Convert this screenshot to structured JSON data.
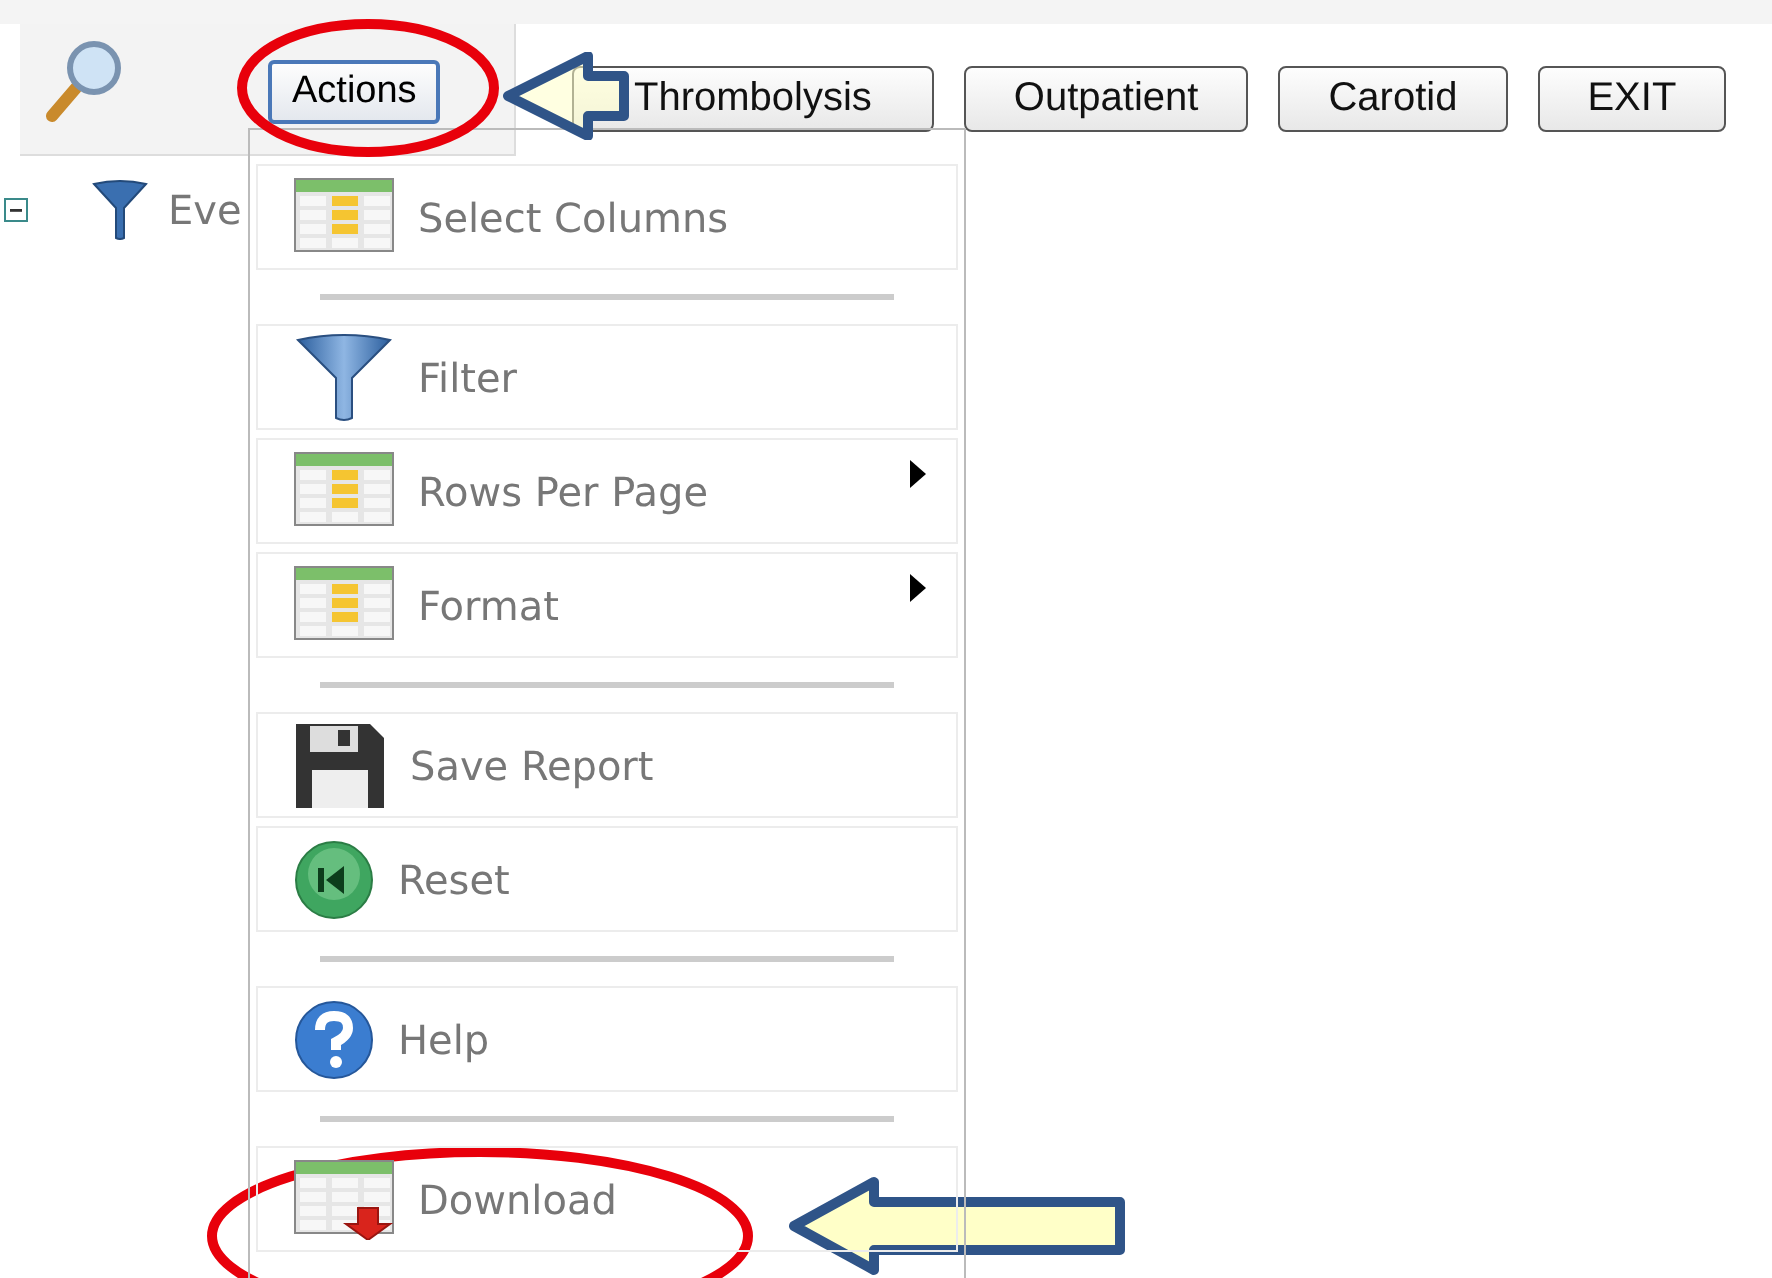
{
  "toolbar": {
    "actions_button": "Actions",
    "buttons": [
      "Thrombolysis",
      "Outpatient",
      "Carotid",
      "EXIT"
    ]
  },
  "tree": {
    "items": [
      {
        "label": "Eve",
        "expanded": true
      }
    ]
  },
  "menu": {
    "items": [
      {
        "kind": "item",
        "label": "Select Columns",
        "submenu": false
      },
      {
        "kind": "separator"
      },
      {
        "kind": "item",
        "label": "Filter",
        "submenu": false
      },
      {
        "kind": "item",
        "label": "Rows Per Page",
        "submenu": true
      },
      {
        "kind": "item",
        "label": "Format",
        "submenu": true
      },
      {
        "kind": "separator"
      },
      {
        "kind": "item",
        "label": "Save Report",
        "submenu": false
      },
      {
        "kind": "item",
        "label": "Reset",
        "submenu": false
      },
      {
        "kind": "separator"
      },
      {
        "kind": "item",
        "label": "Help",
        "submenu": false
      },
      {
        "kind": "separator"
      },
      {
        "kind": "item",
        "label": "Download",
        "submenu": false
      }
    ]
  }
}
